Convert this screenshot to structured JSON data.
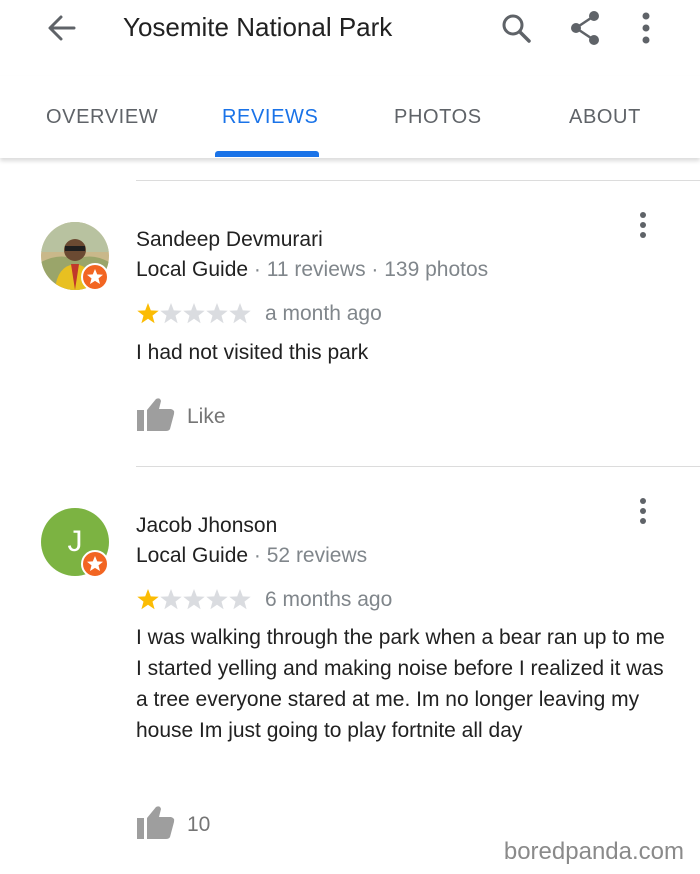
{
  "appbar": {
    "title": "Yosemite National Park",
    "icons": [
      "back-arrow-icon",
      "search-icon",
      "share-icon",
      "more-vert-icon"
    ]
  },
  "tabs": [
    {
      "label": "OVERVIEW",
      "active": false
    },
    {
      "label": "REVIEWS",
      "active": true
    },
    {
      "label": "PHOTOS",
      "active": false
    },
    {
      "label": "ABOUT",
      "active": false
    }
  ],
  "colors": {
    "accent": "#1a73e8",
    "star_filled": "#fbbc04",
    "star_empty": "#dadce0",
    "guide_badge": "#f26522",
    "avatar_jacob": "#7cb342"
  },
  "reviews": [
    {
      "author": "Sandeep Devmurari",
      "guide_label": "Local Guide",
      "meta": "· 11 reviews · 139 photos",
      "rating": 1,
      "rating_max": 5,
      "date": "a month ago",
      "text": "I had not visited this park",
      "like_label": "Like"
    },
    {
      "author": "Jacob Jhonson",
      "avatar_letter": "J",
      "guide_label": "Local Guide",
      "meta": "· 52 reviews",
      "rating": 1,
      "rating_max": 5,
      "date": "6 months ago",
      "text": "I was walking through the park when a bear ran up to me I started yelling and making noise before I realized it was a tree everyone stared at me. Im no longer leaving my house Im just going to play fortnite all day",
      "like_label": "10"
    }
  ],
  "watermark": "boredpanda.com"
}
